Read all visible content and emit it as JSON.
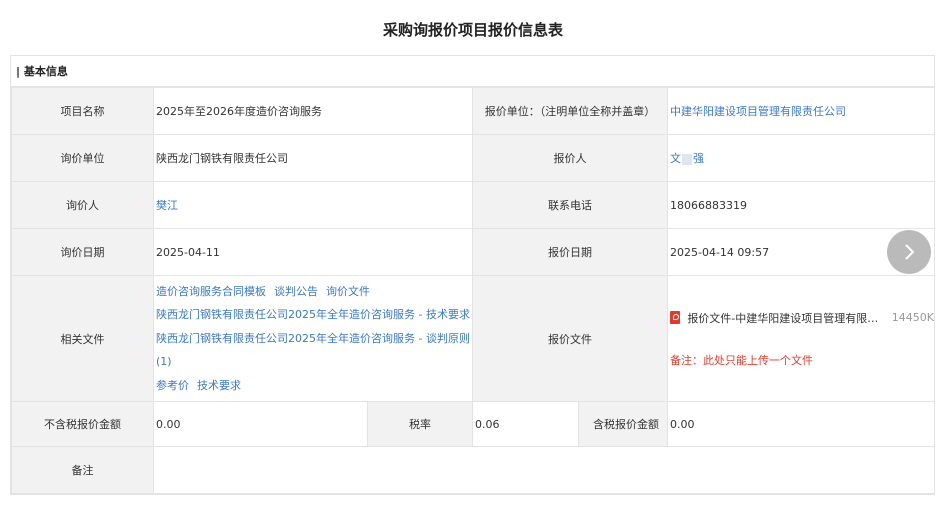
{
  "page_title": "采购询报价项目报价信息表",
  "section_header": "| 基本信息",
  "rows": {
    "project_name_label": "项目名称",
    "project_name_value": "2025年至2026年度造价咨询服务",
    "quote_unit_label": "报价单位：（注明单位全称并盖章）",
    "quote_unit_value": "中建华阳建设项目管理有限责任公司",
    "inquiry_unit_label": "询价单位",
    "inquiry_unit_value": "陕西龙门钢铁有限责任公司",
    "quoter_label": "报价人",
    "quoter_value_start": "文",
    "quoter_value_end": "强",
    "inquirer_label": "询价人",
    "inquirer_value": "樊江",
    "contact_label": "联系电话",
    "contact_value": "18066883319",
    "inquiry_date_label": "询价日期",
    "inquiry_date_value": "2025-04-11",
    "quote_date_label": "报价日期",
    "quote_date_value": "2025-04-14 09:57",
    "related_docs_label": "相关文件",
    "related_docs": {
      "line1": [
        "造价咨询服务合同模板",
        "谈判公告",
        "询价文件"
      ],
      "line2": "陕西龙门钢铁有限责任公司2025年全年造价咨询服务 - 技术要求",
      "line3": "陕西龙门钢铁有限责任公司2025年全年造价咨询服务 - 谈判原则",
      "line4": "(1)",
      "line5": [
        "参考价",
        "技术要求"
      ]
    },
    "quote_file_label": "报价文件",
    "quote_file_name": "报价文件-中建华阳建设项目管理有限责任公司",
    "quote_file_size": "14450K",
    "quote_file_note": "备注：此处只能上传一个文件",
    "untaxed_amount_label": "不含税报价金额",
    "untaxed_amount_value": "0.00",
    "tax_rate_label": "税率",
    "tax_rate_value": "0.06",
    "taxed_amount_label": "含税报价金额",
    "taxed_amount_value": "0.00",
    "remarks_label": "备注",
    "remarks_value": ""
  },
  "icons": {
    "pdf": "pdf-file-icon",
    "next": "chevron-right-icon"
  },
  "colors": {
    "link": "#3a78c9",
    "note": "#e23c2c",
    "label_bg": "#f2f2f2",
    "border": "#e3e3e3"
  }
}
